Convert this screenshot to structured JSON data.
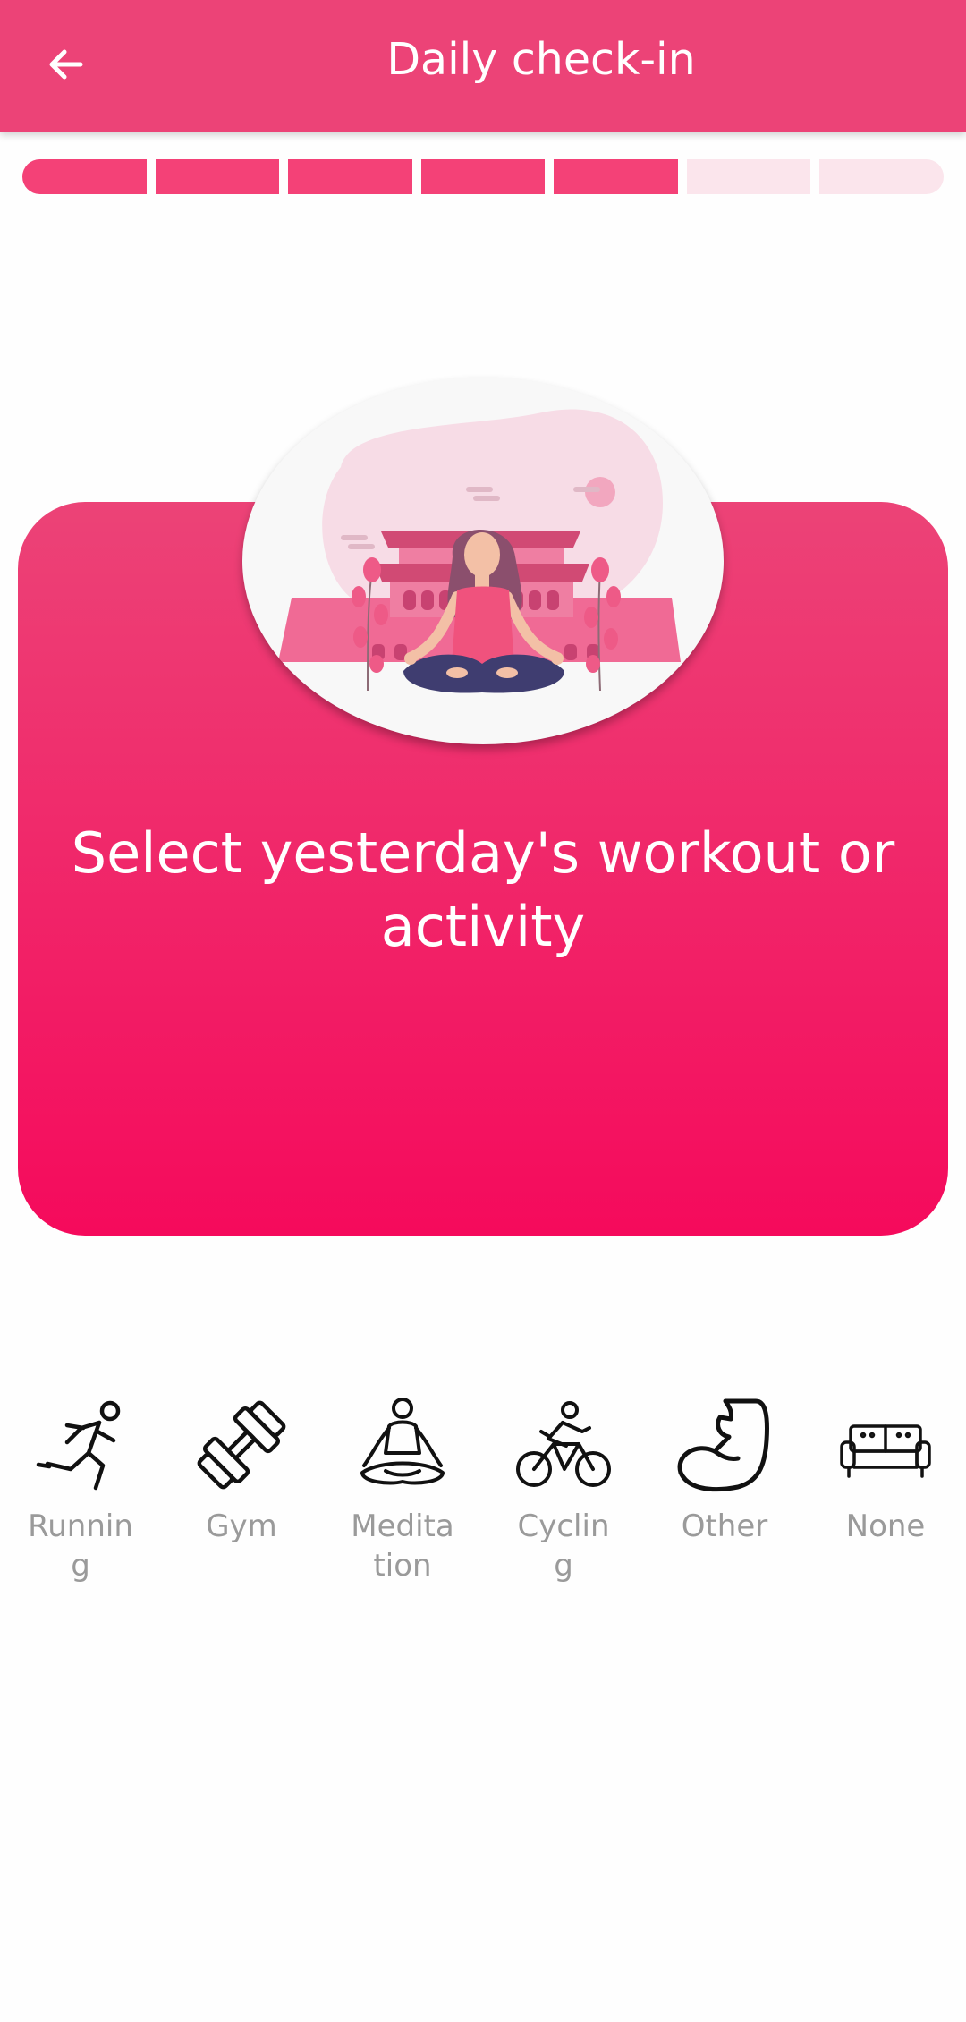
{
  "header": {
    "title": "Daily check-in",
    "back_icon": "arrow-left-icon"
  },
  "progress": {
    "total_steps": 7,
    "completed_steps": 5,
    "active_color": "#f44177",
    "inactive_color": "#fbe5ec"
  },
  "hero": {
    "title": "Select yesterday's workout or activity",
    "illustration": "meditation-illustration"
  },
  "activities": [
    {
      "label": "Running",
      "icon": "running-icon"
    },
    {
      "label": "Gym",
      "icon": "dumbbell-icon"
    },
    {
      "label": "Meditation",
      "icon": "meditation-icon"
    },
    {
      "label": "Cycling",
      "icon": "cycling-icon"
    },
    {
      "label": "Other",
      "icon": "flexed-arm-icon"
    },
    {
      "label": "None",
      "icon": "sofa-icon"
    }
  ],
  "colors": {
    "primary": "#ec4377",
    "gradient_end": "#f50a5c",
    "label_gray": "#9a9a9a"
  }
}
